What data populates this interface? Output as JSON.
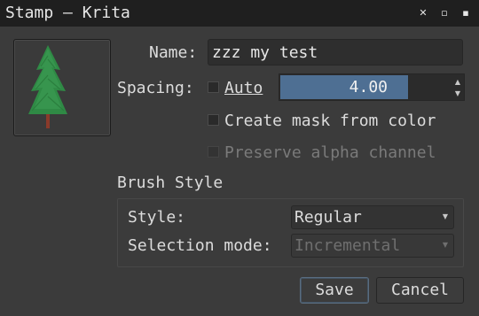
{
  "window": {
    "title": "Stamp — Krita",
    "close_glyph": "✕",
    "maximize_glyph": "▫",
    "minimize_glyph": "▪"
  },
  "form": {
    "name_label": "Name:",
    "name_value": "zzz my test",
    "spacing_label": "Spacing:",
    "auto_label": "Auto",
    "auto_checked": false,
    "spacing_value": "4.00",
    "spacing_fill_fraction": 0.7,
    "create_mask_label": "Create mask from color",
    "create_mask_checked": false,
    "preserve_alpha_label": "Preserve alpha channel",
    "preserve_alpha_checked": false,
    "preserve_alpha_enabled": false
  },
  "brush_style": {
    "group_title": "Brush Style",
    "style_label": "Style:",
    "style_value": "Regular",
    "selection_mode_label": "Selection mode:",
    "selection_mode_value": "Incremental",
    "selection_mode_enabled": false
  },
  "buttons": {
    "save_label": "Save",
    "cancel_label": "Cancel"
  },
  "preview": {
    "icon": "tree-brush-preview-icon"
  },
  "colors": {
    "accent": "#4e6f93",
    "background": "#3b3b3b",
    "titlebar": "#1f1f1f",
    "tree_green": "#2f8a45",
    "tree_trunk": "#8a3a2a"
  }
}
